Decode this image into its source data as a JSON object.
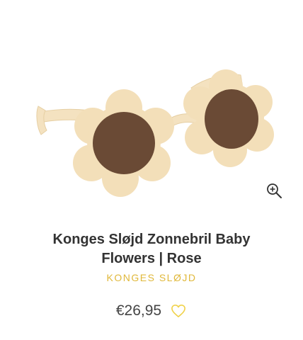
{
  "product": {
    "title_line1": "Konges Sløjd Zonnebril Baby",
    "title_line2": "Flowers | Rose",
    "brand": "KONGES SLØJD",
    "price": "€26,95"
  },
  "icons": {
    "zoom": "zoom-in-icon",
    "wishlist": "heart-outline-icon"
  },
  "colors": {
    "brand_text": "#e0b83a",
    "title_text": "#333333",
    "frame": "#f3dfb9",
    "lens": "#6a4a35",
    "heart": "#f0d24a"
  }
}
